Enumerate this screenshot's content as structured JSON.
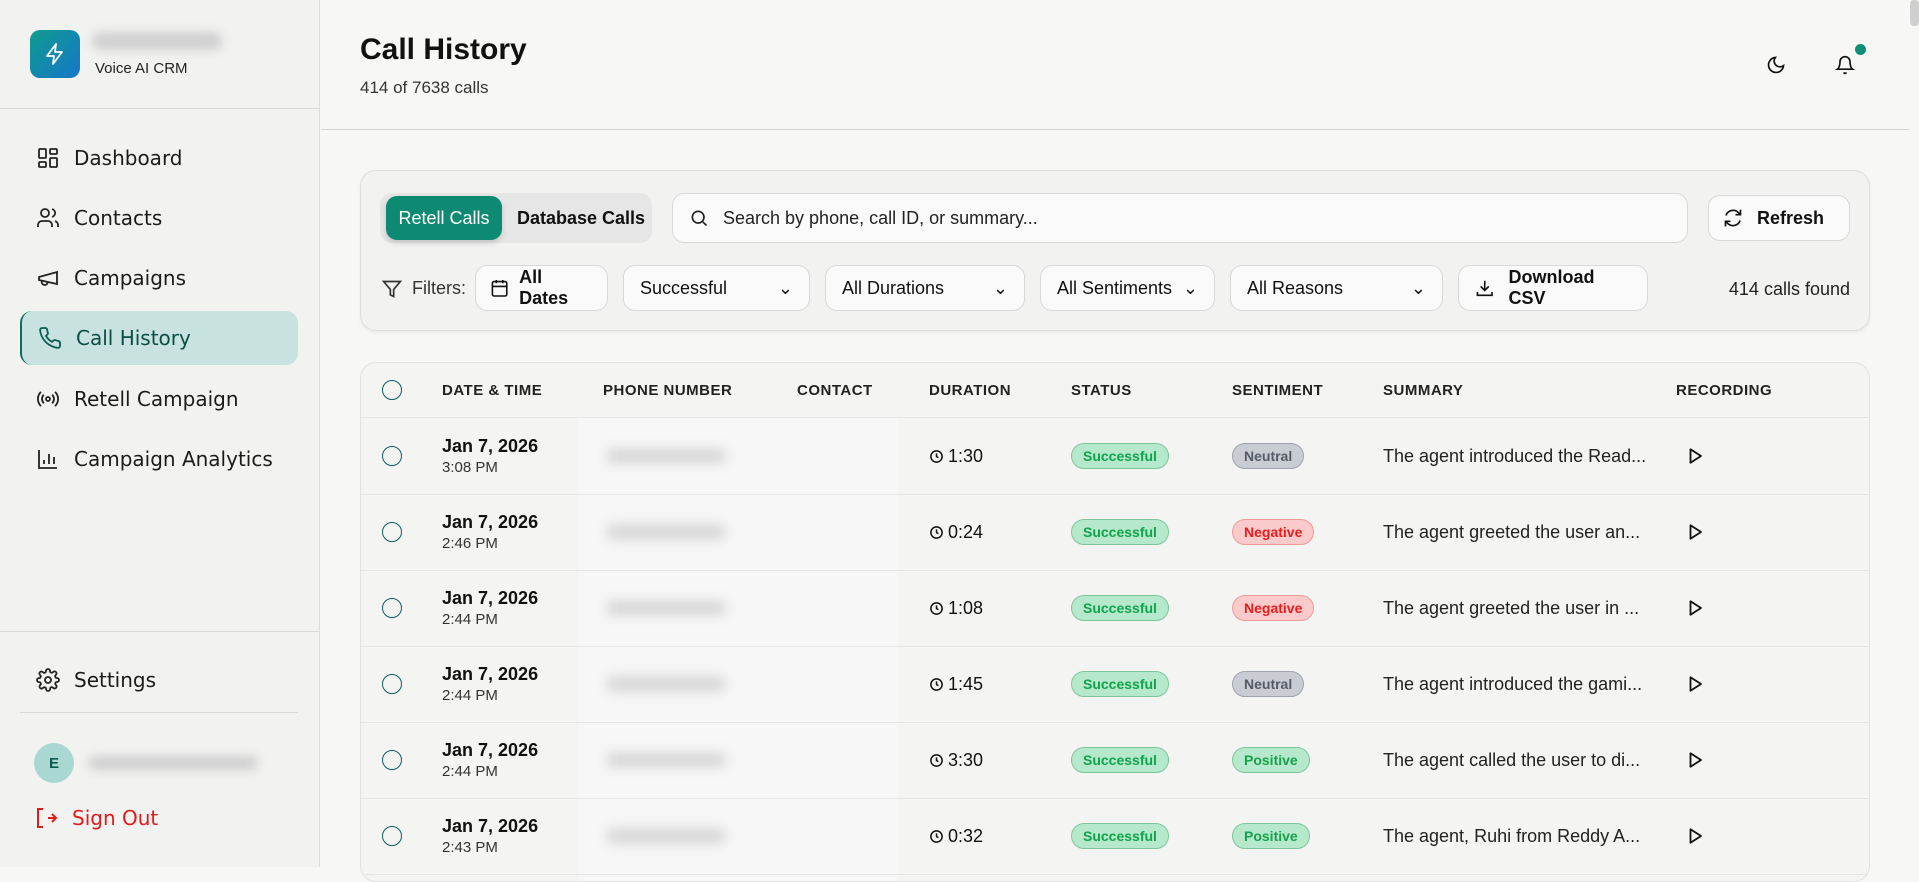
{
  "sidebar": {
    "brand_subtitle": "Voice AI CRM",
    "nav": [
      {
        "label": "Dashboard",
        "icon": "dashboard-icon"
      },
      {
        "label": "Contacts",
        "icon": "users-icon"
      },
      {
        "label": "Campaigns",
        "icon": "megaphone-icon"
      },
      {
        "label": "Call History",
        "icon": "phone-icon",
        "active": true
      },
      {
        "label": "Retell Campaign",
        "icon": "broadcast-icon"
      },
      {
        "label": "Campaign Analytics",
        "icon": "bar-chart-icon"
      }
    ],
    "settings_label": "Settings",
    "avatar_initial": "E",
    "sign_out_label": "Sign Out"
  },
  "header": {
    "title": "Call History",
    "subtitle": "414 of 7638 calls"
  },
  "toolbar": {
    "tabs": [
      "Retell Calls",
      "Database Calls"
    ],
    "search_placeholder": "Search by phone, call ID, or summary...",
    "refresh_label": "Refresh",
    "filters_label": "Filters:",
    "dates_label": "All Dates",
    "status_filter": "Successful",
    "duration_filter": "All Durations",
    "sentiment_filter": "All Sentiments",
    "reason_filter": "All Reasons",
    "download_label": "Download CSV",
    "found_text": "414 calls found"
  },
  "table": {
    "columns": [
      "DATE & TIME",
      "PHONE NUMBER",
      "CONTACT",
      "DURATION",
      "STATUS",
      "SENTIMENT",
      "SUMMARY",
      "RECORDING"
    ],
    "rows": [
      {
        "date": "Jan 7, 2026",
        "time": "3:08 PM",
        "duration": "1:30",
        "status": "Successful",
        "sentiment": "Neutral",
        "summary": "The agent introduced the Read..."
      },
      {
        "date": "Jan 7, 2026",
        "time": "2:46 PM",
        "duration": "0:24",
        "status": "Successful",
        "sentiment": "Negative",
        "summary": "The agent greeted the user an..."
      },
      {
        "date": "Jan 7, 2026",
        "time": "2:44 PM",
        "duration": "1:08",
        "status": "Successful",
        "sentiment": "Negative",
        "summary": "The agent greeted the user in ..."
      },
      {
        "date": "Jan 7, 2026",
        "time": "2:44 PM",
        "duration": "1:45",
        "status": "Successful",
        "sentiment": "Neutral",
        "summary": "The agent introduced the gami..."
      },
      {
        "date": "Jan 7, 2026",
        "time": "2:44 PM",
        "duration": "3:30",
        "status": "Successful",
        "sentiment": "Positive",
        "summary": "The agent called the user to di..."
      },
      {
        "date": "Jan 7, 2026",
        "time": "2:43 PM",
        "duration": "0:32",
        "status": "Successful",
        "sentiment": "Positive",
        "summary": "The agent, Ruhi from Reddy A..."
      }
    ]
  },
  "colors": {
    "accent": "#0e8a72",
    "active_nav_bg": "#c8e3df",
    "danger": "#e01b1b"
  }
}
